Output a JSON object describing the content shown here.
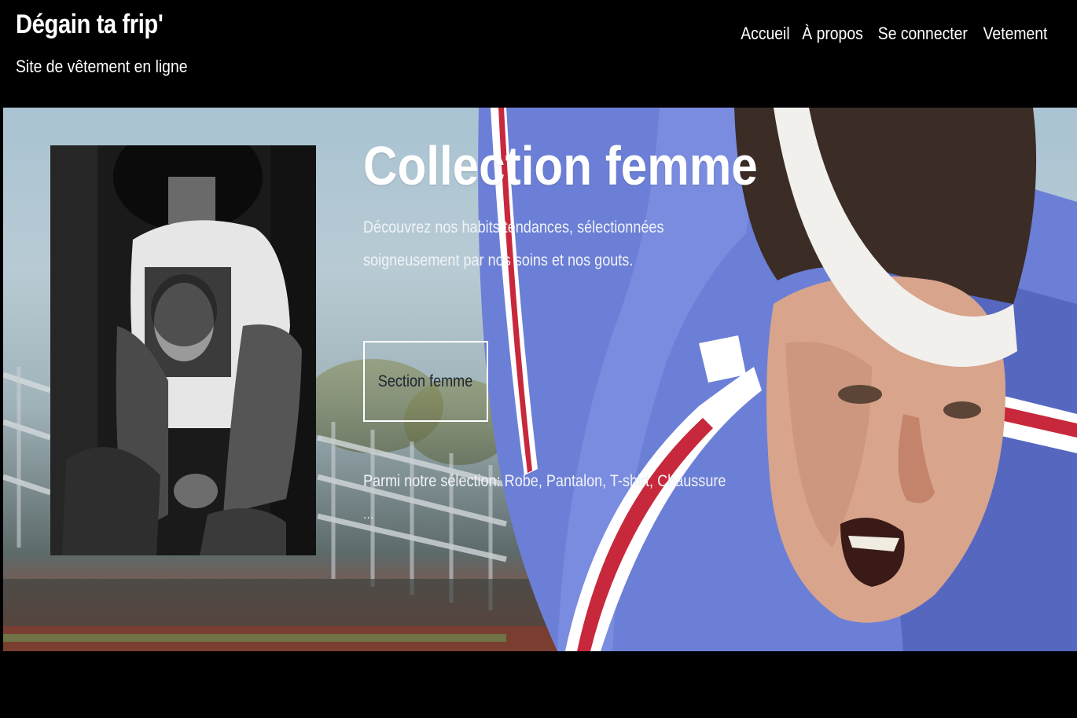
{
  "header": {
    "brand_title": "Dégain ta frip'",
    "brand_subtitle": "Site de vêtement en ligne",
    "nav": [
      {
        "label": "Accueil"
      },
      {
        "label": "À propos"
      },
      {
        "label": "Se connecter"
      },
      {
        "label": "Vetement"
      }
    ]
  },
  "hero": {
    "title": "Collection femme",
    "description": "Découvrez nos habits tendances, sélectionnées soigneusement par nos soins et nos gouts.",
    "button_label": "Section femme",
    "selection_text": "Parmi notre sélection: Robe, Pantalon, T-shirt, Chaussure",
    "ellipsis": "..."
  },
  "colors": {
    "header_bg": "#000000",
    "text": "#ffffff",
    "jacket_blue": "#6c7fd6",
    "stripe_red": "#c8283c"
  }
}
